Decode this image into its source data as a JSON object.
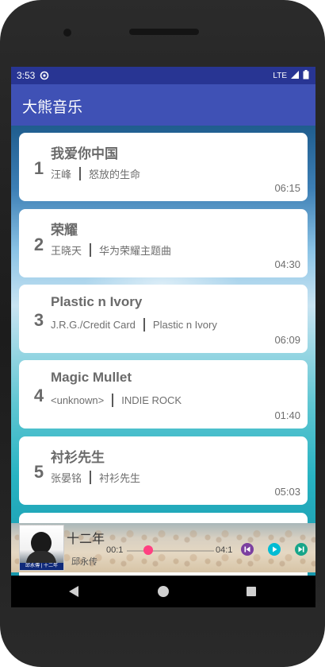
{
  "status_bar": {
    "time": "3:53",
    "network": "LTE"
  },
  "app_bar": {
    "title": "大熊音乐"
  },
  "songs": [
    {
      "index": "1",
      "title": "我爱你中国",
      "artist": "汪峰",
      "album": "怒放的生命",
      "duration": "06:15"
    },
    {
      "index": "2",
      "title": "荣耀",
      "artist": "王晓天",
      "album": "华为荣耀主题曲",
      "duration": "04:30"
    },
    {
      "index": "3",
      "title": "Plastic n Ivory",
      "artist": "J.R.G./Credit Card",
      "album": "Plastic n Ivory",
      "duration": "06:09"
    },
    {
      "index": "4",
      "title": "Magic Mullet",
      "artist": "<unknown>",
      "album": "INDIE ROCK",
      "duration": "01:40"
    },
    {
      "index": "5",
      "title": "衬衫先生",
      "artist": "张晏铭",
      "album": "衬衫先生",
      "duration": "05:03"
    }
  ],
  "player": {
    "title": "十二年",
    "artist": "邱永传",
    "current_time": "00:1",
    "total_time": "04:1",
    "cover_text": "邱永傳 | 十二年",
    "colors": {
      "thumb": "#ff4081",
      "prev": "#7b3fa0",
      "play": "#00bcd4",
      "next": "#17a589"
    }
  },
  "nav_icons": [
    "back-icon",
    "home-icon",
    "recents-icon"
  ]
}
